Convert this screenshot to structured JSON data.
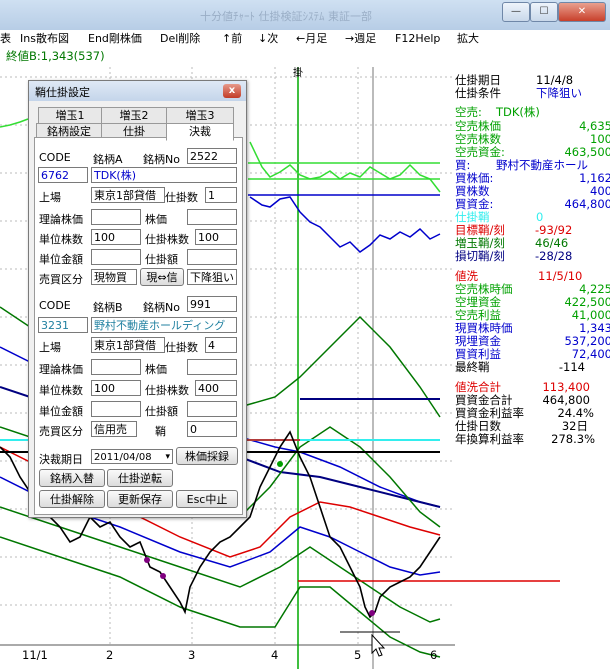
{
  "window": {
    "faded_title": "十分値ﾁｬｰﾄ 仕掛検証ｼｽﾃﾑ 東証一部",
    "min": "—",
    "max": "☐",
    "close": "✕"
  },
  "menu": [
    "表",
    "Ins散布図",
    "End剛株価",
    "Del削除",
    "↑前",
    "↓次",
    "←月足",
    "→週足",
    "F12Help",
    "拡大"
  ],
  "top_readout": "終値B:1,343(537)",
  "chart_marker": "掛",
  "x_ticks": [
    "11/1",
    "2",
    "3",
    "4",
    "5",
    "6"
  ],
  "info": {
    "period_label": "仕掛期日",
    "period": "11/4/8",
    "cond_label": "仕掛条件",
    "cond": "下降狙い",
    "short_label": "空売:",
    "short_name": "TDK(株)",
    "rows_a": [
      {
        "k": "空売株価",
        "v": "4,635"
      },
      {
        "k": "空売株数",
        "v": "100"
      },
      {
        "k": "空売資金:",
        "v": "463,500"
      }
    ],
    "buy_label": "買:",
    "buy_name": "野村不動産ホール",
    "rows_b": [
      {
        "k": "買株価:",
        "v": "1,162"
      },
      {
        "k": "買株数",
        "v": "400"
      },
      {
        "k": "買資金:",
        "v": "464,800"
      }
    ],
    "pos_label": "仕掛鞘",
    "pos_val": "0",
    "rows_c": [
      {
        "k": "目標鞘/刻",
        "v": "-93/92"
      },
      {
        "k": "増玉鞘/刻",
        "v": "46/46"
      },
      {
        "k": "損切鞘/刻",
        "v": "-28/28"
      }
    ],
    "close_label": "値洗",
    "close_date": "11/5/10",
    "rows_d": [
      {
        "k": "空売株時価",
        "v": "4,225"
      },
      {
        "k": "空埋資金",
        "v": "422,500"
      },
      {
        "k": "空売利益",
        "v": "41,000"
      }
    ],
    "rows_e": [
      {
        "k": "現買株時価",
        "v": "1,343"
      },
      {
        "k": "現埋資金",
        "v": "537,200"
      },
      {
        "k": "買資利益",
        "v": "72,400"
      }
    ],
    "min_label": "最終鞘",
    "min_val": "-114",
    "total_label": "値洗合計",
    "total_val": "113,400",
    "rows_f": [
      {
        "k": "買資金合計",
        "v": "464,800"
      },
      {
        "k": "買資金利益率",
        "v": "24.4%"
      },
      {
        "k": "仕掛日数",
        "v": "32日"
      },
      {
        "k": "年換算利益率",
        "v": "278.3%"
      }
    ]
  },
  "dialog": {
    "title": "鞘仕掛設定",
    "close": "x",
    "tabs_row1": [
      "増玉1",
      "増玉2",
      "増玉3"
    ],
    "tabs_row2": [
      "銘柄設定",
      "仕掛",
      "決裁"
    ],
    "a": {
      "code_label": "CODE",
      "name_label": "銘柄A",
      "no_label": "銘柄No",
      "no": "2522",
      "code": "6762",
      "name": "TDK(株)",
      "market_label": "上場",
      "market": "東京1部貸借",
      "qty_label": "仕掛数",
      "qty": "1",
      "theo_label": "理論株価",
      "price_label": "株価",
      "price": "",
      "unit_label": "単位株数",
      "unit": "100",
      "lot_label": "仕掛株数",
      "lot": "100",
      "amt_label": "単位金額",
      "sum_label": "仕掛額",
      "sum": "",
      "side_label": "売買区分",
      "side": "現物買",
      "swap": "現⇔信",
      "mode": "下降狙い"
    },
    "b": {
      "code_label": "CODE",
      "name_label": "銘柄B",
      "no_label": "銘柄No",
      "no": "991",
      "code": "3231",
      "name": "野村不動産ホールディング",
      "market_label": "上場",
      "market": "東京1部貸借",
      "qty_label": "仕掛数",
      "qty": "4",
      "theo_label": "理論株価",
      "price_label": "株価",
      "price": "",
      "unit_label": "単位株数",
      "unit": "100",
      "lot_label": "仕掛株数",
      "lot": "400",
      "amt_label": "単位金額",
      "sum_label": "仕掛額",
      "sum": "",
      "side_label": "売買区分",
      "side": "信用売",
      "sp_label": "鞘",
      "sp": "0"
    },
    "date_label": "決裁期日",
    "date": "2011/04/08",
    "pick": "株価採録",
    "swap_names": "銘柄入替",
    "reverse": "仕掛逆転",
    "cancel": "仕掛解除",
    "save": "更新保存",
    "esc": "Esc中止"
  },
  "colors": {
    "green": "#00a000",
    "bright_green": "#33dd33",
    "blue": "#0000cc",
    "navy": "#000080",
    "red": "#dd0000",
    "cyan": "#33eeee"
  }
}
